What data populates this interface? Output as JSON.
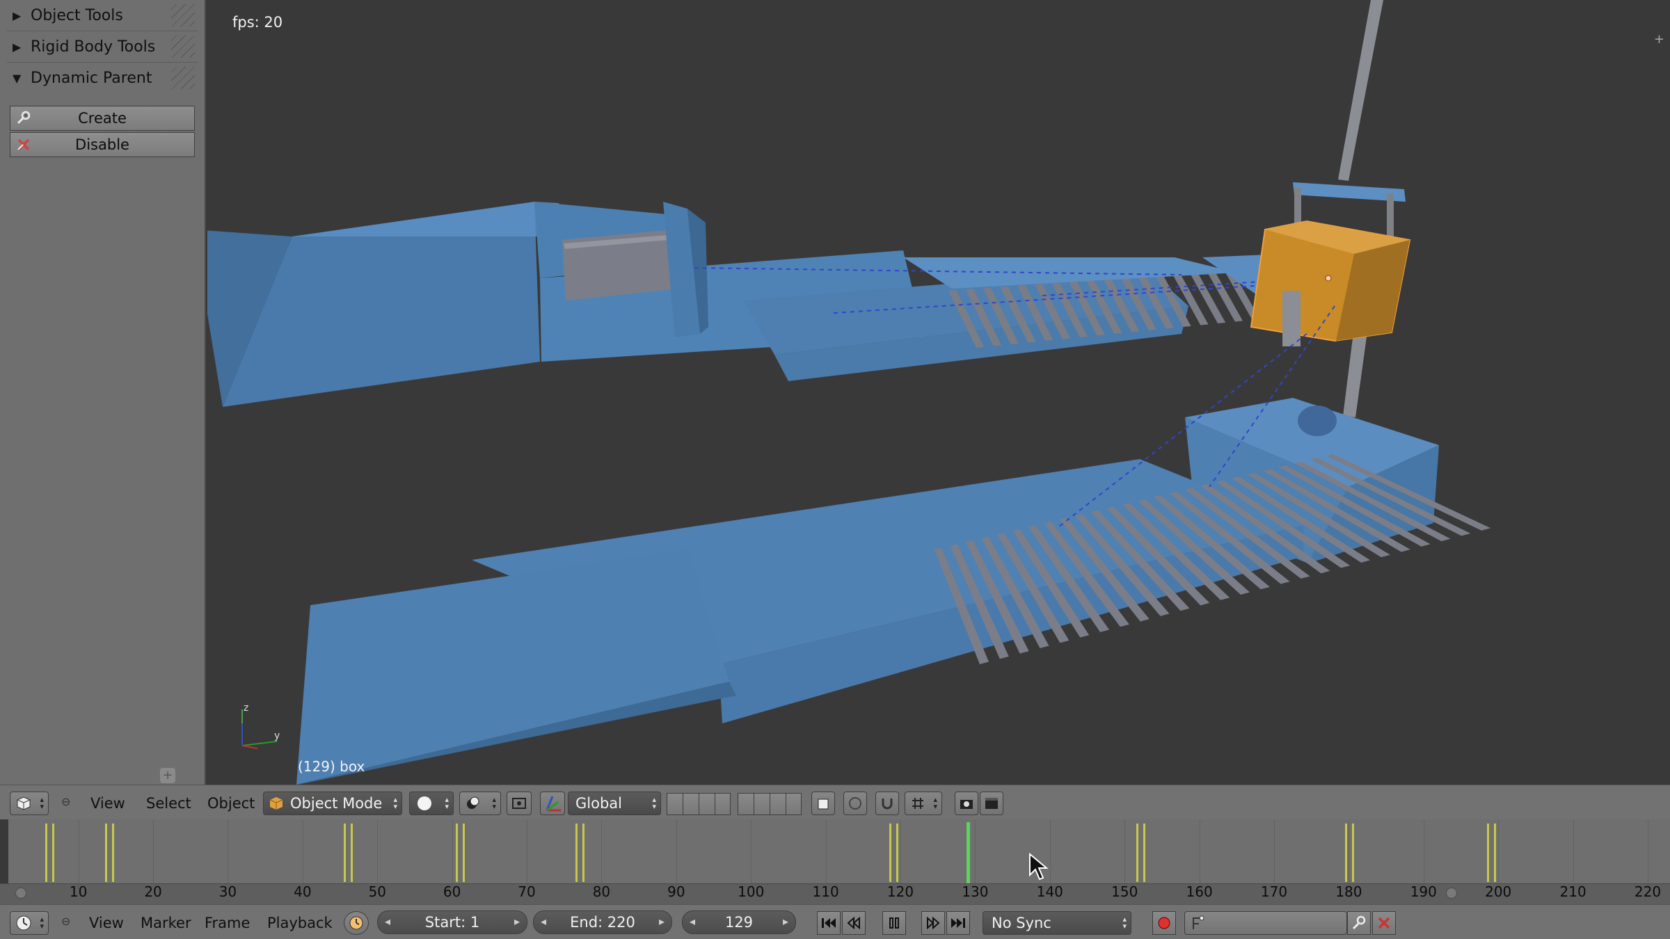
{
  "toolshelf": {
    "panels": [
      {
        "label": "Object Tools",
        "expanded": false
      },
      {
        "label": "Rigid Body Tools",
        "expanded": false
      },
      {
        "label": "Dynamic Parent",
        "expanded": true
      }
    ],
    "create_label": "Create",
    "disable_label": "Disable"
  },
  "viewport": {
    "fps": "fps: 20",
    "object_info": "(129) box",
    "axis_z": "z",
    "axis_y": "y"
  },
  "view_header": {
    "menus": [
      "View",
      "Select",
      "Object"
    ],
    "mode": "Object Mode",
    "orientation": "Global"
  },
  "timeline": {
    "ticks": [
      "10",
      "20",
      "30",
      "40",
      "50",
      "60",
      "70",
      "80",
      "90",
      "100",
      "110",
      "120",
      "130",
      "140",
      "150",
      "160",
      "170",
      "180",
      "190",
      "200",
      "210",
      "220"
    ],
    "current_frame": 129,
    "keyframes": [
      6,
      14,
      46,
      61,
      77,
      119,
      152,
      180,
      199
    ]
  },
  "timeline_header": {
    "menus": [
      "View",
      "Marker",
      "Frame",
      "Playback"
    ],
    "start": "Start: 1",
    "end": "End: 220",
    "frame": "129",
    "sync": "No Sync"
  },
  "colors": {
    "object_blue": "#4e7fb0",
    "selected_orange": "#d8972e",
    "keyframe": "#c8c84a",
    "playhead": "#5fd35f"
  }
}
